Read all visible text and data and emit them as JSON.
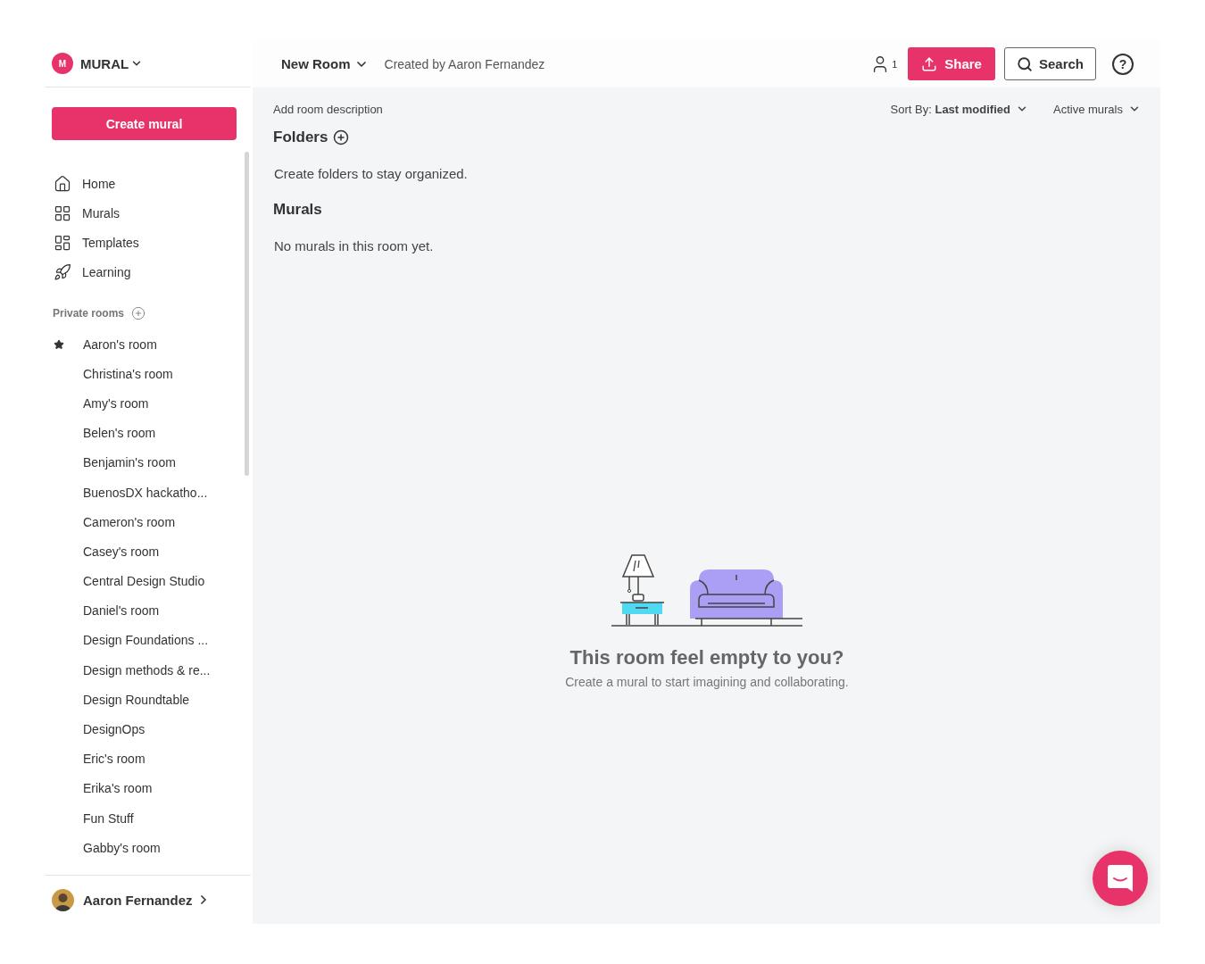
{
  "workspace": {
    "initial": "M",
    "name": "MURAL"
  },
  "create_button": "Create mural",
  "nav": [
    {
      "label": "Home",
      "selected": false
    },
    {
      "label": "Murals",
      "selected": false
    },
    {
      "label": "Templates",
      "selected": false
    },
    {
      "label": "Learning",
      "selected": false
    }
  ],
  "private_rooms": {
    "title": "Private rooms",
    "rooms": [
      {
        "label": "Aaron's room",
        "starred": true
      },
      {
        "label": "Christina's room",
        "starred": false
      },
      {
        "label": "Amy's room",
        "starred": false
      },
      {
        "label": "Belen's room",
        "starred": false
      },
      {
        "label": "Benjamin's room",
        "starred": false
      },
      {
        "label": "BuenosDX hackatho...",
        "starred": false
      },
      {
        "label": "Cameron's room",
        "starred": false
      },
      {
        "label": "Casey's room",
        "starred": false
      },
      {
        "label": "Central Design Studio",
        "starred": false
      },
      {
        "label": "Daniel's room",
        "starred": false
      },
      {
        "label": "Design Foundations ...",
        "starred": false
      },
      {
        "label": "Design methods & re...",
        "starred": false
      },
      {
        "label": "Design Roundtable",
        "starred": false
      },
      {
        "label": "DesignOps",
        "starred": false
      },
      {
        "label": "Eric's room",
        "starred": false
      },
      {
        "label": "Erika's room",
        "starred": false
      },
      {
        "label": "Fun Stuff",
        "starred": false
      },
      {
        "label": "Gabby's room",
        "starred": false
      }
    ]
  },
  "user": {
    "name": "Aaron Fernandez"
  },
  "header": {
    "room": "New Room",
    "created_by": "Created by Aaron Fernandez",
    "members": "1",
    "share": "Share",
    "search": "Search",
    "help": "?"
  },
  "toolbar": {
    "description": "Add room description",
    "sort_label": "Sort By:",
    "sort_value": "Last modified",
    "filter": "Active murals"
  },
  "folders": {
    "title": "Folders",
    "empty": "Create folders to stay organized."
  },
  "murals": {
    "title": "Murals",
    "empty": "No murals in this room yet."
  },
  "empty_state": {
    "title": "This room feel empty to you?",
    "subtitle": "Create a mural to start imagining and collaborating."
  }
}
